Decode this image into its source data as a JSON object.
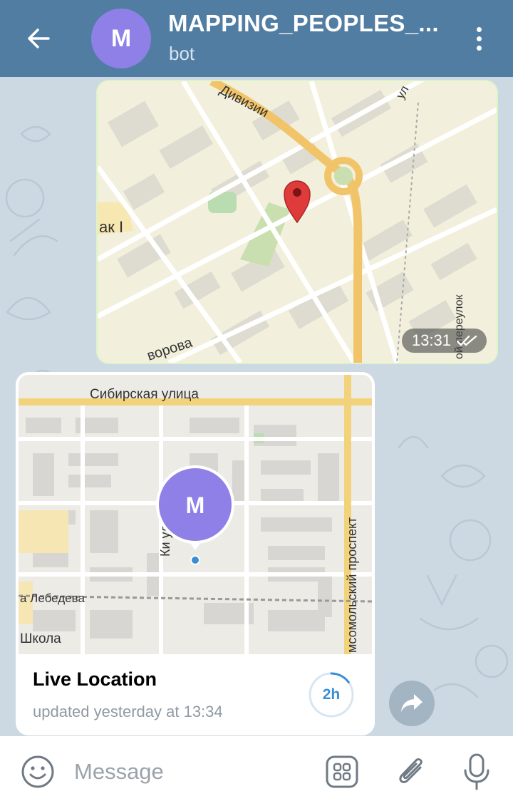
{
  "header": {
    "avatar_letter": "M",
    "title": "MAPPING_PEOPLES_...",
    "subtitle": "bot",
    "back_icon": "arrow-left-icon",
    "menu_icon": "more-vertical-icon"
  },
  "outgoing_message": {
    "type": "location",
    "time": "13:31",
    "status_icon": "double-check-icon",
    "map_labels": {
      "street_top": "Дивизии",
      "street_right": "ул",
      "district": "ак I",
      "street_bottom": "ворова",
      "lane": "ой переулок"
    }
  },
  "incoming_message": {
    "type": "live-location",
    "title": "Live Location",
    "updated": "updated yesterday at 13:34",
    "timer_label": "2h",
    "timer_progress": 0.15,
    "avatar_letter": "M",
    "map_labels": {
      "street_top": "Сибирская улица",
      "street_vertical": "Ки     улица",
      "street_left": "а Лебедева",
      "street_bottom_left": "Школа",
      "avenue": "мсомольский проспект"
    }
  },
  "composer": {
    "placeholder": "Message",
    "emoji_icon": "emoji-icon",
    "bot_commands_icon": "bot-commands-icon",
    "attach_icon": "paperclip-icon",
    "mic_icon": "microphone-icon"
  },
  "colors": {
    "header_bg": "#517da2",
    "avatar_bg": "#8f80e8",
    "outgoing_bubble": "#dcf5c6",
    "chat_bg": "#cdd9e2",
    "accent": "#3a8fd4"
  }
}
